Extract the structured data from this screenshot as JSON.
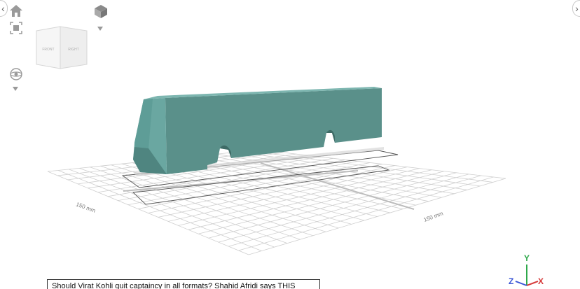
{
  "nav": {
    "left_arrow": "‹",
    "right_arrow": "›"
  },
  "viewcube": {
    "front_label": "FRONT",
    "right_label": "RIGHT"
  },
  "grid": {
    "left_dimension_label": "150 mm",
    "right_dimension_label": "150 mm"
  },
  "news": {
    "headline": "Should Virat Kohli quit captaincy in all formats? Shahid Afridi says THIS"
  },
  "axes": {
    "y_label": "Y",
    "z_label": "Z",
    "x_label": "X",
    "colors": {
      "x": "#d63a3a",
      "y": "#2ea84a",
      "z": "#3a55d6"
    }
  },
  "model": {
    "color": "#5a908a",
    "highlight_color": "#6aa7a1"
  }
}
